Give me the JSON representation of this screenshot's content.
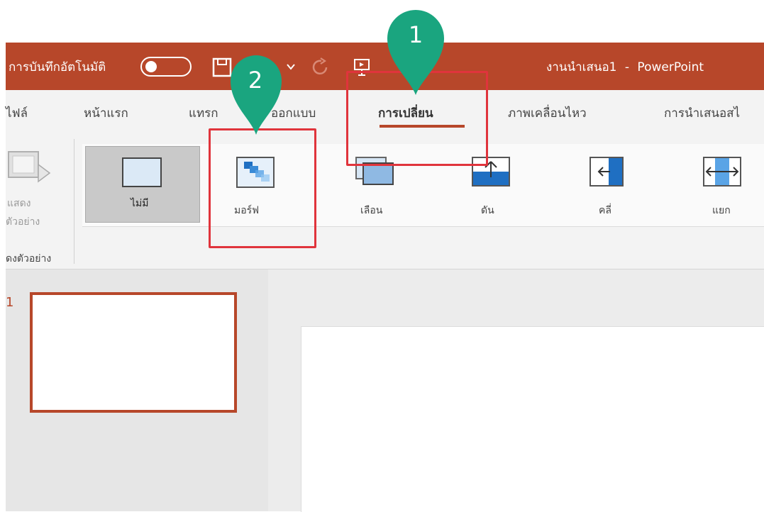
{
  "titlebar": {
    "autosave_label": "การบันทึกอัตโนมัติ",
    "doc_title": "งานนำเสนอ1",
    "separator": "-",
    "app_name": "PowerPoint"
  },
  "tabs": [
    {
      "label": "ไฟล์"
    },
    {
      "label": "หน้าแรก"
    },
    {
      "label": "แทรก"
    },
    {
      "label": "ออกแบบ"
    },
    {
      "label": "การเปลี่ยน"
    },
    {
      "label": "ภาพเคลื่อนไหว"
    },
    {
      "label": "การนำเสนอสไ"
    }
  ],
  "ribbon": {
    "preview_label_line1": "แสดง",
    "preview_label_line2": "ตัวอย่าง",
    "preview_group_label": "ดงตัวอย่าง",
    "transitions": [
      {
        "label": "ไม่มี"
      },
      {
        "label": "มอร์ฟ"
      },
      {
        "label": "เลือน"
      },
      {
        "label": "ดัน"
      },
      {
        "label": "คลี่"
      },
      {
        "label": "แยก"
      }
    ]
  },
  "slides": [
    {
      "number": "1"
    }
  ],
  "annotations": [
    {
      "label": "1"
    },
    {
      "label": "2"
    }
  ],
  "colors": {
    "accent": "#b7472a",
    "highlight": "#e0343c",
    "pin": "#1aa57f"
  }
}
